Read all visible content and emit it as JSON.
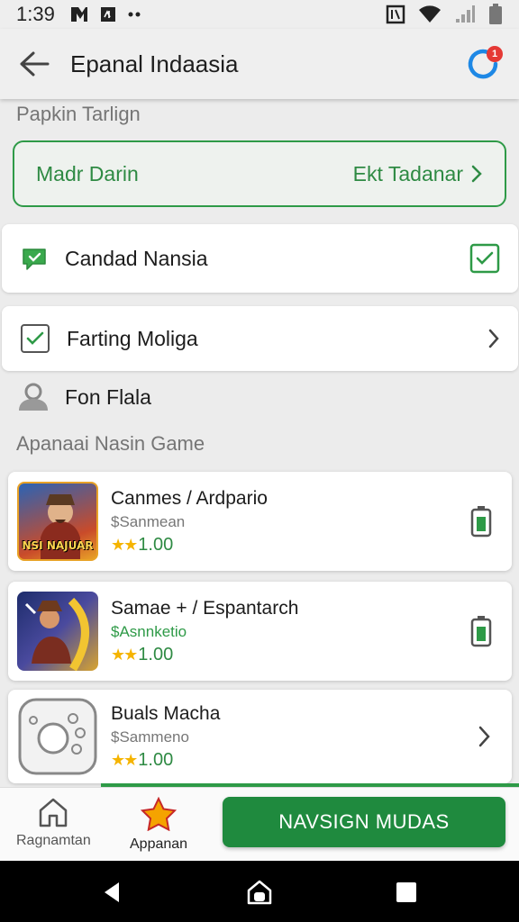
{
  "status_bar": {
    "time": "1:39",
    "icons_left": [
      "notification-icon-1",
      "notification-icon-2",
      "more-dots-icon"
    ],
    "icons_right": [
      "sim-icon",
      "wifi-icon",
      "signal-icon",
      "battery-icon"
    ]
  },
  "app_bar": {
    "title": "Epanal Indaasia",
    "notification_count": "1"
  },
  "section1": {
    "label": "Papkin Tarlign"
  },
  "green_box": {
    "left_text": "Madr Darin",
    "right_text": "Ekt Tadanar"
  },
  "rows": [
    {
      "label": "Candad Nansia"
    },
    {
      "label": "Farting Moliga"
    }
  ],
  "person_row": {
    "label": "Fon Flala"
  },
  "section2": {
    "label": "Apanaai Nasin Game"
  },
  "games": [
    {
      "title": "Canmes / Ardpario",
      "subtitle": "$Sanmean",
      "rating": "1.00",
      "thumb_text": "NSI NAJUAR"
    },
    {
      "title": "Samae + / Espantarch",
      "subtitle": "$Asnnketio",
      "rating": "1.00"
    },
    {
      "title": "Buals Macha",
      "subtitle": "$Sammeno",
      "rating": "1.00"
    }
  ],
  "bottom_nav": {
    "items": [
      {
        "label": "Ragnamtan"
      },
      {
        "label": "Appanan"
      }
    ],
    "cta_label": "NAVSIGN MUDAS"
  },
  "colors": {
    "accent": "#2e9a47",
    "cta": "#1f8a3e",
    "star": "#f5b400"
  }
}
